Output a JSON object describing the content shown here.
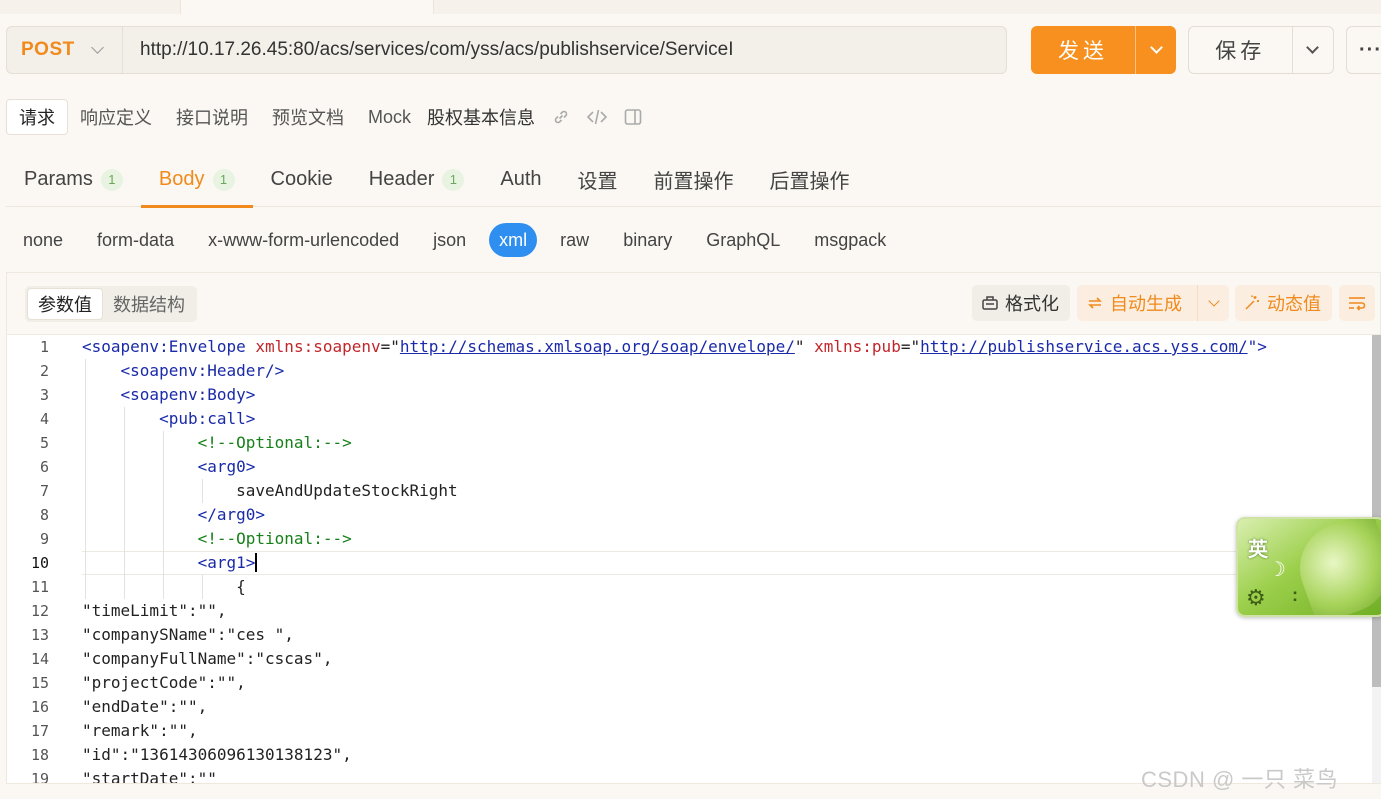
{
  "request": {
    "method": "POST",
    "url": "http://10.17.26.45:80/acs/services/com/yss/acs/publishservice/ServiceI",
    "send_label": "发送",
    "save_label": "保存",
    "more_label": "···"
  },
  "subtabs": {
    "items": [
      {
        "label": "请求"
      },
      {
        "label": "响应定义"
      },
      {
        "label": "接口说明"
      },
      {
        "label": "预览文档"
      },
      {
        "label": "Mock"
      }
    ],
    "title": "股权基本信息"
  },
  "main_tabs": [
    {
      "label": "Params",
      "badge": "1"
    },
    {
      "label": "Body",
      "badge": "1"
    },
    {
      "label": "Cookie"
    },
    {
      "label": "Header",
      "badge": "1"
    },
    {
      "label": "Auth"
    },
    {
      "label": "设置"
    },
    {
      "label": "前置操作"
    },
    {
      "label": "后置操作"
    }
  ],
  "body_types": [
    "none",
    "form-data",
    "x-www-form-urlencoded",
    "json",
    "xml",
    "raw",
    "binary",
    "GraphQL",
    "msgpack"
  ],
  "panel": {
    "seg": [
      "参数值",
      "数据结构"
    ],
    "format_label": "格式化",
    "auto_label": "自动生成",
    "dynamic_label": "动态值"
  },
  "editor": {
    "line_numbers": [
      "1",
      "2",
      "3",
      "4",
      "5",
      "6",
      "7",
      "8",
      "9",
      "10",
      "11",
      "12",
      "13",
      "14",
      "15",
      "16",
      "17",
      "18",
      "19"
    ],
    "l1": {
      "open": "<soapenv:Envelope",
      "attr1": "xmlns:soapenv",
      "url1": "http://schemas.xmlsoap.org/soap/envelope/",
      "attr2": "xmlns:pub",
      "url2": "http://publishservice.acs.yss.com/"
    },
    "l2": "<soapenv:Header/>",
    "l3": "<soapenv:Body>",
    "l4": "<pub:call>",
    "l5": "<!--Optional:-->",
    "l6": "<arg0>",
    "l7": "saveAndUpdateStockRight",
    "l8": "</arg0>",
    "l9": "<!--Optional:-->",
    "l10_a": "<arg1",
    "l10_b": ">",
    "l11": "{",
    "l12": "\"timeLimit\":\"\",",
    "l13": "\"companySName\":\"ces \",",
    "l14": "\"companyFullName\":\"cscas\",",
    "l15": "\"projectCode\":\"\",",
    "l16": "\"endDate\":\"\",",
    "l17": "\"remark\":\"\",",
    "l18": "\"id\":\"1361430609613013812З\",",
    "l19": "\"startDate\":\"\""
  },
  "ime": {
    "label": "英"
  },
  "watermark": "CSDN @ 一只 菜鸟",
  "colors": {
    "accent": "#f08a1c",
    "send_button": "#f7901e",
    "xml_chip": "#2f8ff0"
  }
}
